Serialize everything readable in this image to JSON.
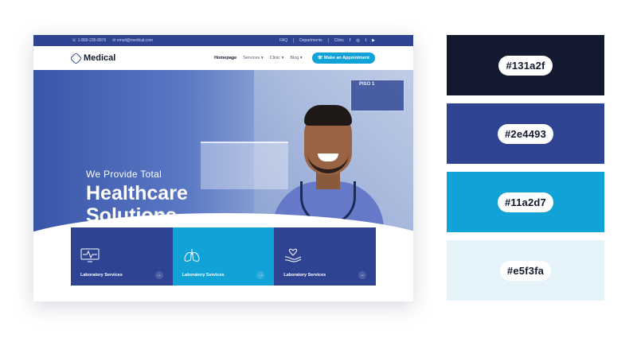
{
  "topbar": {
    "phone": "1-800-235-8976",
    "email": "email@medical.com",
    "links": [
      "FAQ",
      "Departments",
      "Clinic"
    ],
    "social": [
      "f",
      "◎",
      "t",
      "▶"
    ]
  },
  "nav": {
    "logo_text": "Medical",
    "items": [
      "Homepage",
      "Services ▾",
      "Clinic ▾",
      "Blog ▾"
    ],
    "cta": "Make an Appointment"
  },
  "hero": {
    "subtitle": "We Provide Total",
    "title_line1": "Healthcare",
    "title_line2": "Solutions",
    "sign_text": "PISO 1"
  },
  "cards": [
    {
      "label": "Laboratory Services",
      "icon": "monitor-heartbeat-icon"
    },
    {
      "label": "Laboratory Services",
      "icon": "lungs-icon"
    },
    {
      "label": "Laboratory Services",
      "icon": "hand-heart-icon"
    }
  ],
  "palette": [
    {
      "hex": "#131a2f",
      "label": "#131a2f"
    },
    {
      "hex": "#2e4493",
      "label": "#2e4493"
    },
    {
      "hex": "#11a2d7",
      "label": "#11a2d7"
    },
    {
      "hex": "#e5f3fa",
      "label": "#e5f3fa"
    }
  ]
}
